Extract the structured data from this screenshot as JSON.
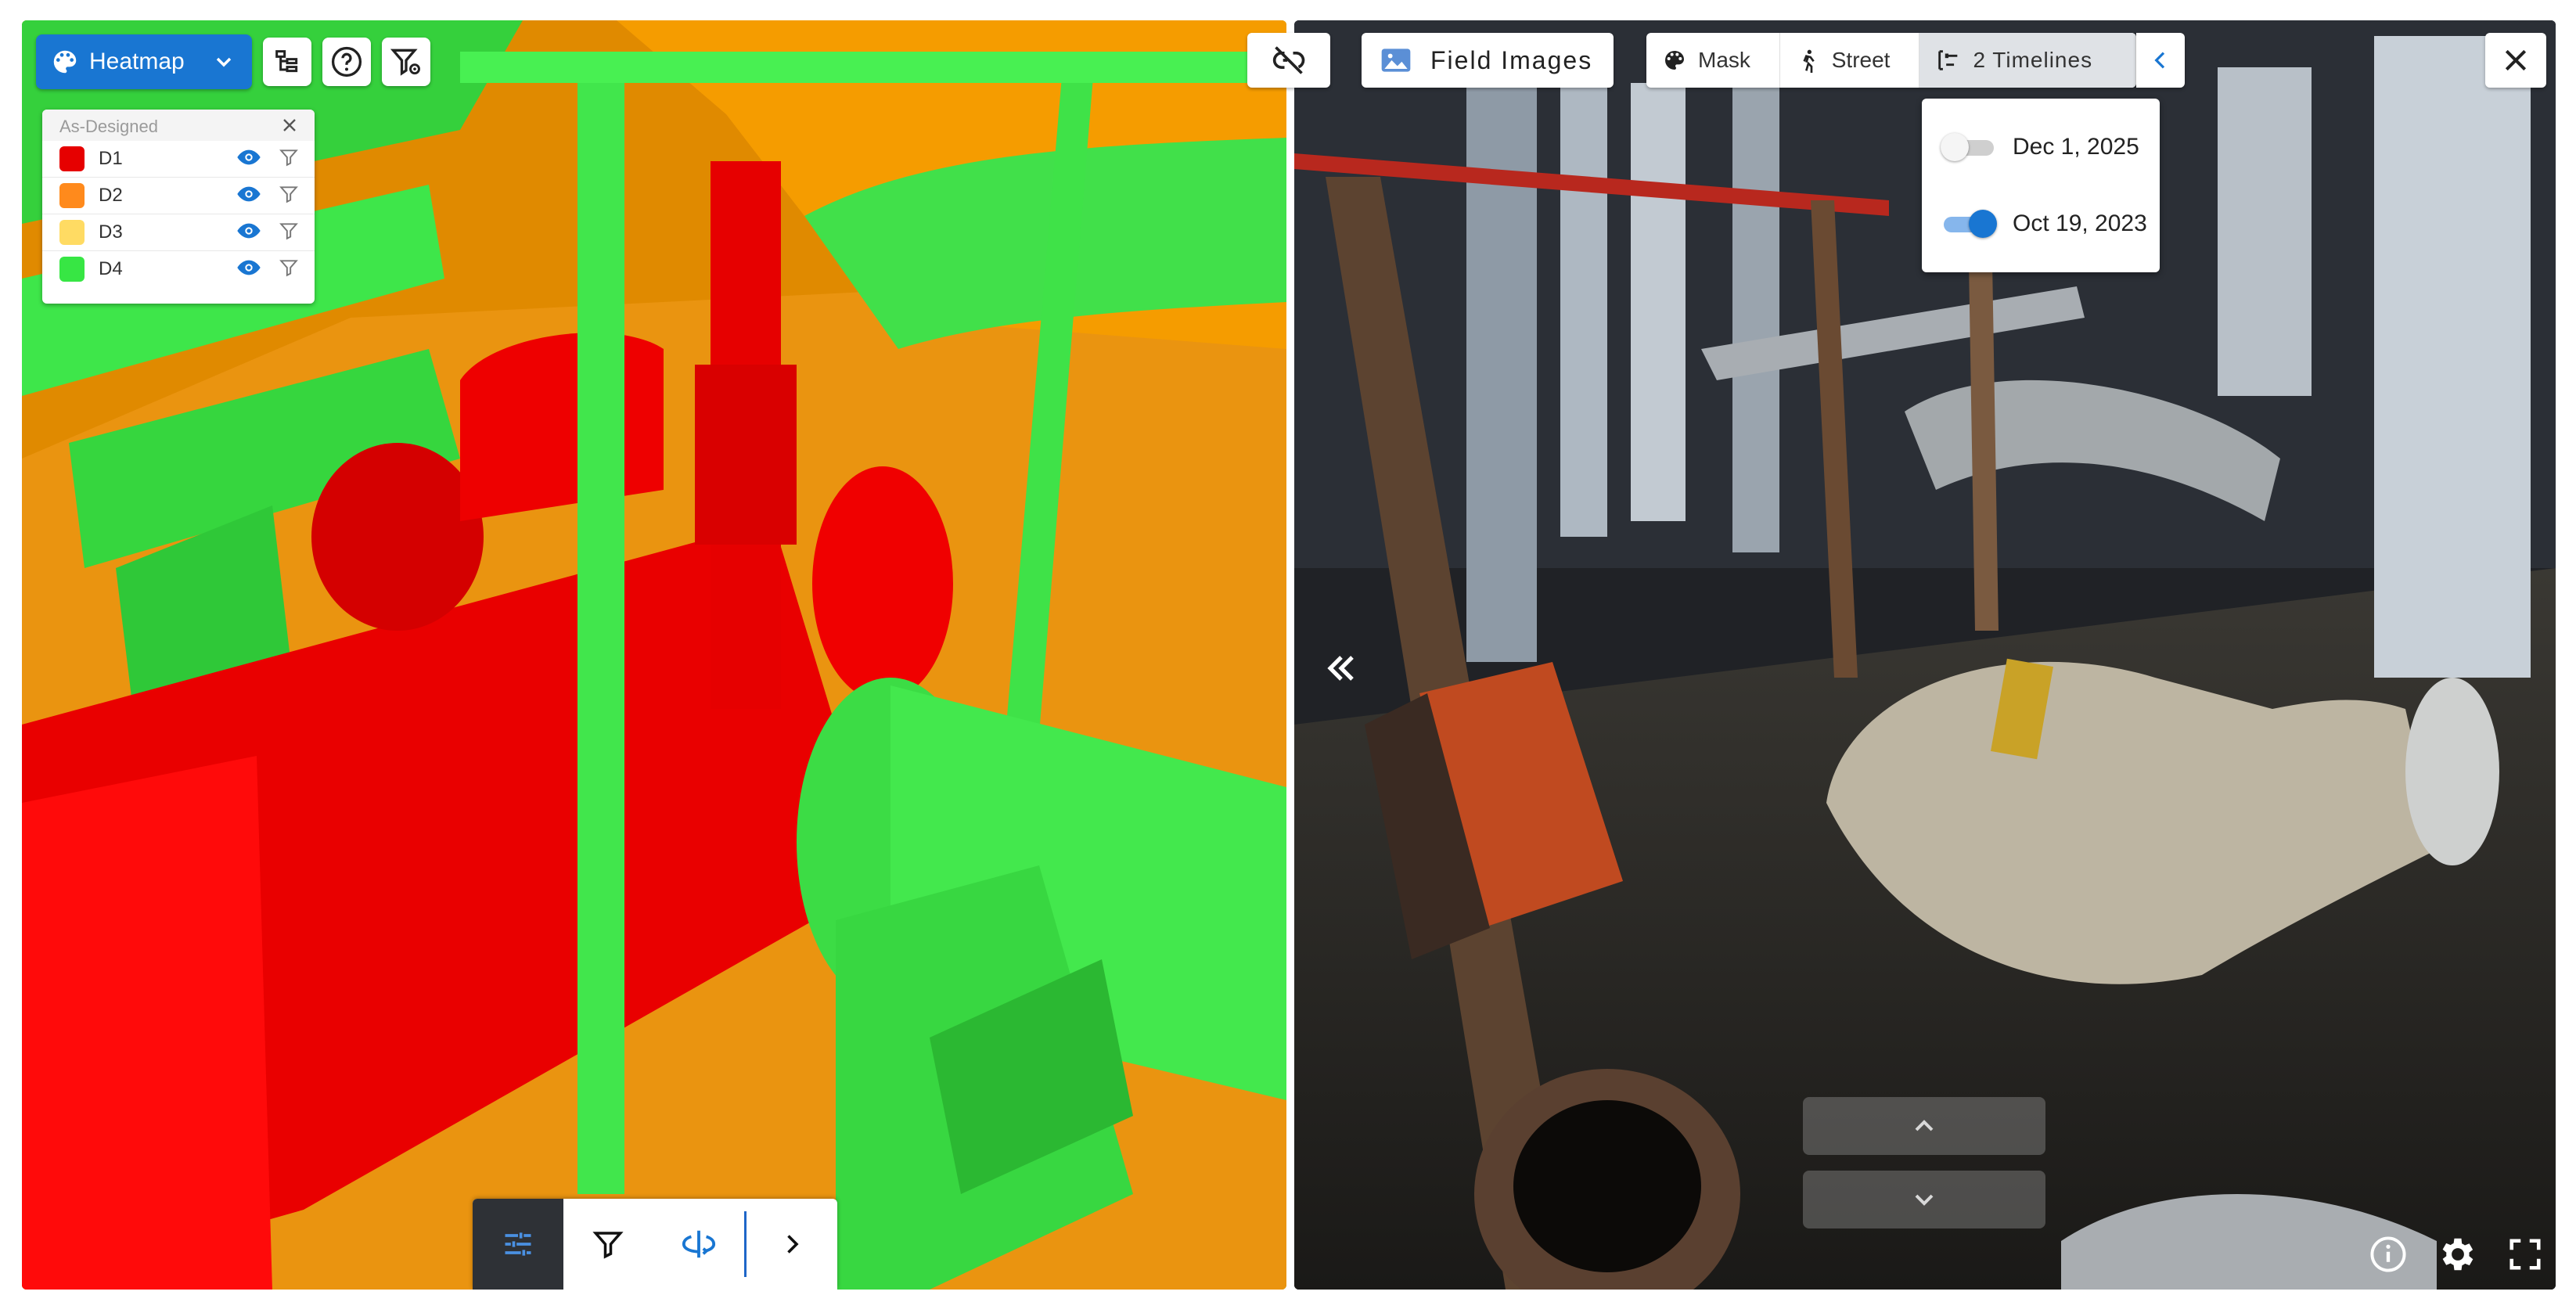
{
  "left_pane": {
    "heatmap_button_label": "Heatmap",
    "legend": {
      "title": "As-Designed",
      "items": [
        {
          "label": "D1",
          "color": "#e60000"
        },
        {
          "label": "D2",
          "color": "#ff8a1c"
        },
        {
          "label": "D3",
          "color": "#ffdb63"
        },
        {
          "label": "D4",
          "color": "#37e644"
        }
      ]
    },
    "toolbar_icons": [
      "tree-icon",
      "help-icon",
      "filter-settings-icon"
    ],
    "bottom_bar_icons": [
      "sliders-icon",
      "filter-icon",
      "rotate-3d-icon",
      "chevron-right-icon"
    ]
  },
  "right_pane": {
    "unlink_icon": "link-off-icon",
    "field_images_label": "Field Images",
    "mask_label": "Mask",
    "street_label": "Street",
    "timelines_label": "2 Timelines",
    "timelines": [
      {
        "label": "Dec 1, 2025",
        "enabled": false
      },
      {
        "label": "Oct 19, 2023",
        "enabled": true
      }
    ],
    "accent_color": "#1976d2"
  }
}
